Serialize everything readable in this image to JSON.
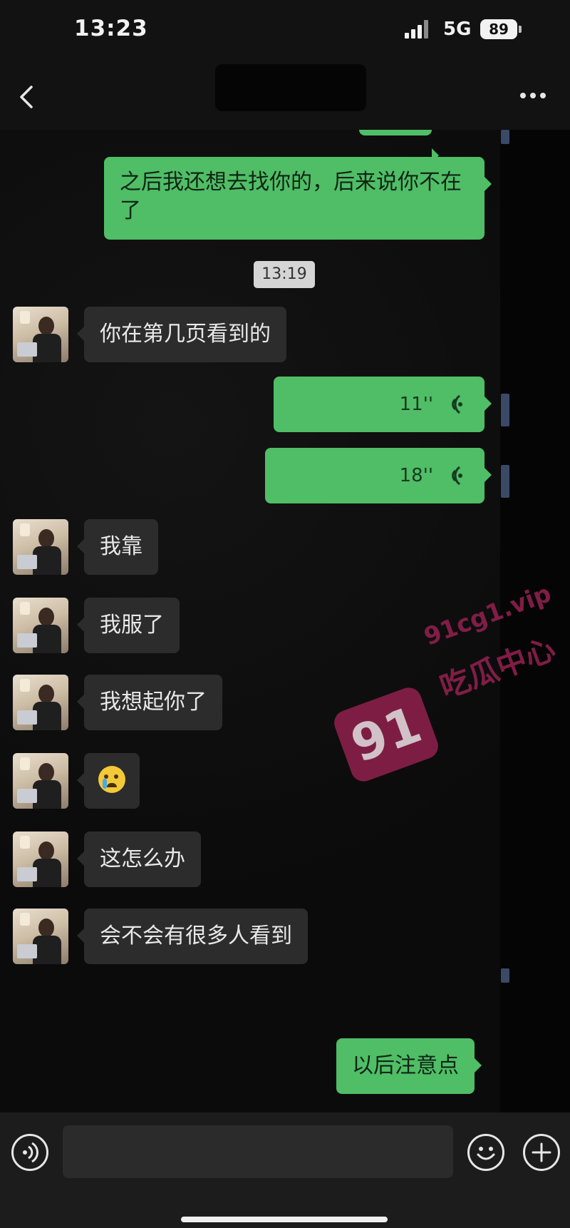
{
  "status_bar": {
    "time": "13:23",
    "network": "5G",
    "battery": "89"
  },
  "header": {
    "title_redacted": true
  },
  "messages": [
    {
      "side": "out",
      "type": "text",
      "text": "之后我还想去找你的，后来说你不在了"
    },
    {
      "side": "center",
      "type": "timestamp",
      "text": "13:19"
    },
    {
      "side": "in",
      "type": "text",
      "text": "你在第几页看到的"
    },
    {
      "side": "out",
      "type": "voice",
      "duration": "11''"
    },
    {
      "side": "out",
      "type": "voice",
      "duration": "18''"
    },
    {
      "side": "in",
      "type": "text",
      "text": "我靠"
    },
    {
      "side": "in",
      "type": "text",
      "text": "我服了"
    },
    {
      "side": "in",
      "type": "text",
      "text": "我想起你了"
    },
    {
      "side": "in",
      "type": "emoji",
      "icon": "crying-face-emoji"
    },
    {
      "side": "in",
      "type": "text",
      "text": "这怎么办"
    },
    {
      "side": "in",
      "type": "text",
      "text": "会不会有很多人看到"
    },
    {
      "side": "out",
      "type": "text",
      "text": "以后注意点"
    }
  ],
  "watermark": {
    "badge": "91",
    "url": "91cg1.vip",
    "name": "吃瓜中心",
    "color": "#8b1f4b"
  },
  "input_bar": {
    "placeholder": ""
  },
  "colors": {
    "outgoing_bubble": "#4fbe66",
    "incoming_bubble": "#2c2c2c",
    "background": "#0d0d0d"
  }
}
